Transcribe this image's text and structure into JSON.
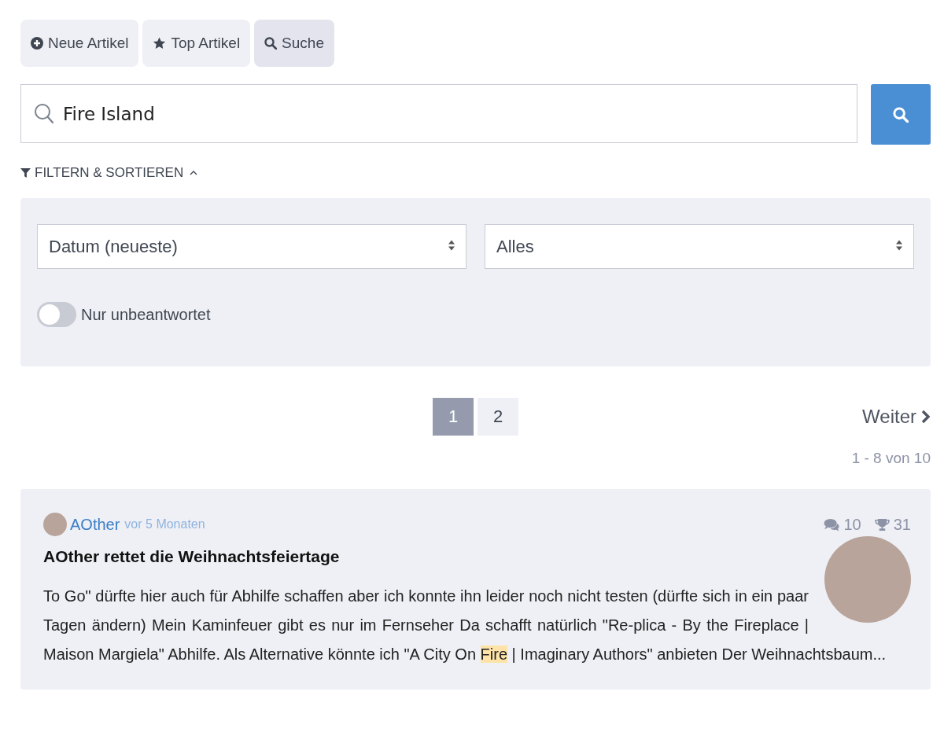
{
  "tabs": [
    {
      "label": "Neue Artikel",
      "selected": false
    },
    {
      "label": "Top Artikel",
      "selected": false
    },
    {
      "label": "Suche",
      "selected": true
    }
  ],
  "search": {
    "value": "Fire Island"
  },
  "filter": {
    "label": "FILTERN & SORTIEREN",
    "expanded": true,
    "selects": [
      "Datum (neueste)",
      "Alles"
    ],
    "toggle": {
      "label": "Nur unbeantwortet",
      "on": false
    }
  },
  "pagination": {
    "pages": [
      {
        "label": "1",
        "selected": true
      },
      {
        "label": "2",
        "selected": false
      }
    ],
    "next": "Weiter",
    "range": "1 - 8 von 10"
  },
  "posts": [
    {
      "author": "AOther",
      "time": "vor 5 Monaten",
      "comments": "10",
      "trophies": "31",
      "title": "AOther rettet die Weihnachtsfeiertage",
      "excerpt": [
        {
          "text": "To Go\"  dürfte hier auch für Abhilfe schaffen aber ich konnte ihn leider noch nicht testen (dürfte sich in ein paar Tagen ändern) Mein Kaminfeuer gibt es nur im Fernseher Da schafft natürlich \"Re-plica - By the Fireplace | Maison Margiela\" Abhilfe. Als Alternative könnte ich \"A City On ",
          "highlight": false
        },
        {
          "text": "Fire",
          "highlight": true
        },
        {
          "text": " | Imaginary Authors\" anbieten Der Weihnachtsbaum...",
          "highlight": false
        }
      ]
    }
  ]
}
